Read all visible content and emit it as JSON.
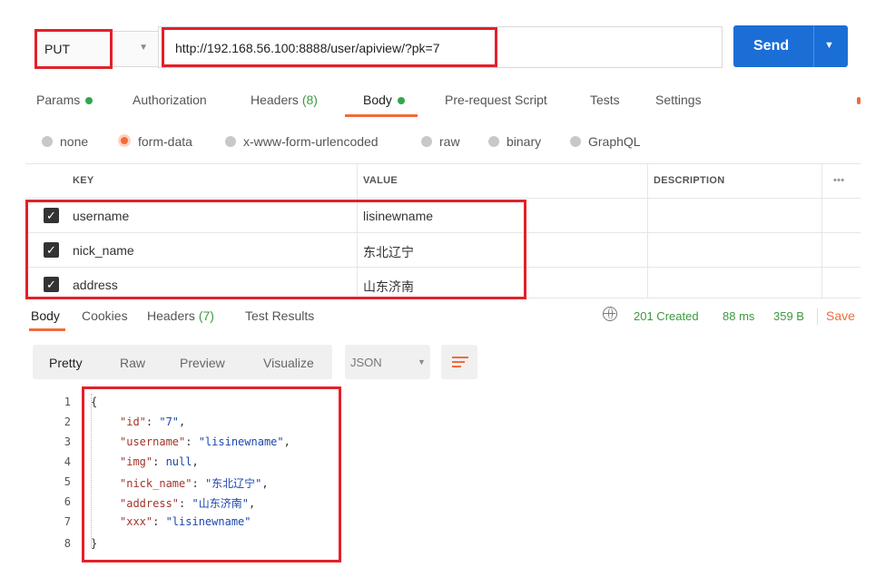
{
  "request": {
    "method": "PUT",
    "url": "http://192.168.56.100:8888/user/apiview/?pk=7",
    "send_label": "Send"
  },
  "tabs": {
    "params": "Params",
    "authorization": "Authorization",
    "headers": "Headers",
    "headers_count": "(8)",
    "body": "Body",
    "pre_request": "Pre-request Script",
    "tests": "Tests",
    "settings": "Settings"
  },
  "body_types": {
    "none": "none",
    "form_data": "form-data",
    "urlencoded": "x-www-form-urlencoded",
    "raw": "raw",
    "binary": "binary",
    "graphql": "GraphQL"
  },
  "table": {
    "headers": {
      "key": "KEY",
      "value": "VALUE",
      "description": "DESCRIPTION",
      "more": "•••"
    },
    "rows": [
      {
        "key": "username",
        "value": "lisinewname"
      },
      {
        "key": "nick_name",
        "value": "东北辽宁"
      },
      {
        "key": "address",
        "value": "山东济南"
      }
    ]
  },
  "response": {
    "tabs": {
      "body": "Body",
      "cookies": "Cookies",
      "headers": "Headers",
      "headers_count": "(7)",
      "test_results": "Test Results"
    },
    "status": "201 Created",
    "time": "88 ms",
    "size": "359 B",
    "save": "Save",
    "views": {
      "pretty": "Pretty",
      "raw": "Raw",
      "preview": "Preview",
      "visualize": "Visualize"
    },
    "format": "JSON",
    "lines": {
      "n1": "1",
      "n2": "2",
      "n3": "3",
      "n4": "4",
      "n5": "5",
      "n6": "6",
      "n7": "7",
      "n8": "8",
      "open": "{",
      "close": "}",
      "k_id": "\"id\"",
      "v_id": "\"7\"",
      "k_username": "\"username\"",
      "v_username": "\"lisinewname\"",
      "k_img": "\"img\"",
      "v_img": "null",
      "k_nick": "\"nick_name\"",
      "v_nick": "\"东北辽宁\"",
      "k_address": "\"address\"",
      "v_address": "\"山东济南\"",
      "k_xxx": "\"xxx\"",
      "v_xxx": "\"lisinewname\""
    }
  }
}
